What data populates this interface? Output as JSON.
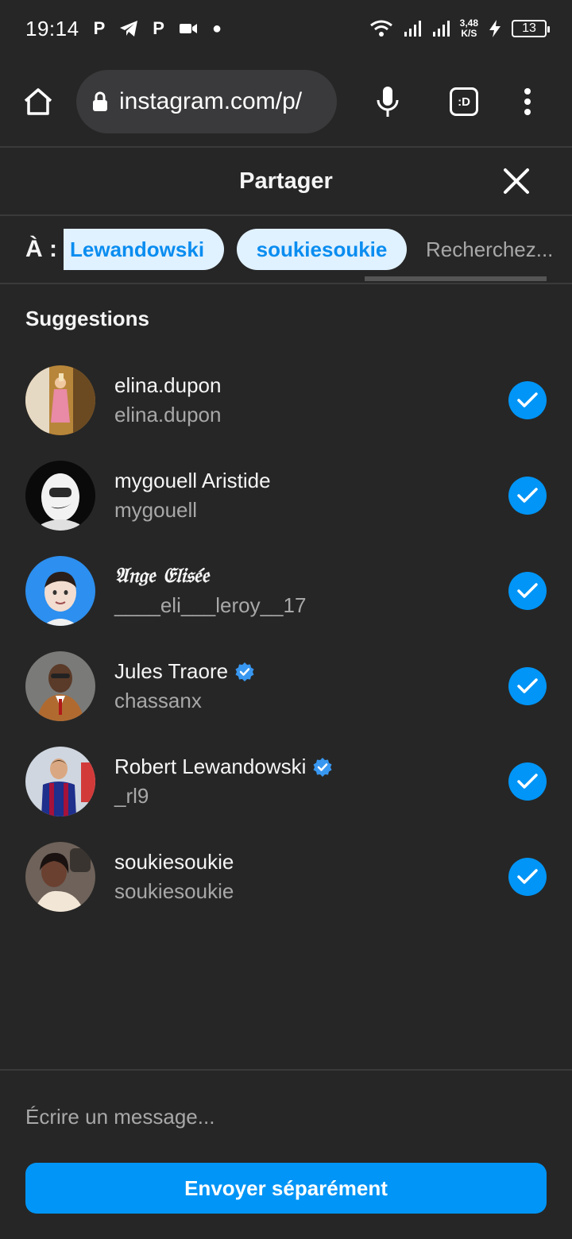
{
  "status_bar": {
    "time": "19:14",
    "speed": "3,48",
    "speed_unit": "K/S",
    "battery": "13",
    "icons": [
      "p-app-icon",
      "telegram-icon",
      "p-app-icon",
      "video-icon",
      "dot-icon",
      "wifi-icon",
      "signal-icon",
      "signal-icon",
      "charging-icon"
    ]
  },
  "browser": {
    "url": "instagram.com/p/",
    "tabs_label": ":D"
  },
  "share": {
    "title": "Partager",
    "to_label": "À :",
    "chips": [
      "Lewandowski",
      "soukiesoukie"
    ],
    "search_placeholder": "Recherchez...",
    "suggestions_title": "Suggestions"
  },
  "suggestions": [
    {
      "fullname": "elina.dupon",
      "username": "elina.dupon",
      "verified": false,
      "selected": true
    },
    {
      "fullname": "mygouell Aristide",
      "username": "mygouell",
      "verified": false,
      "selected": true
    },
    {
      "fullname": "𝔄𝔫𝔤𝔢 𝔈𝔩𝔦𝔰𝔢́𝔢",
      "username": "____eli___leroy__17",
      "verified": false,
      "selected": true
    },
    {
      "fullname": "Jules Traore",
      "username": "chassanx",
      "verified": true,
      "selected": true
    },
    {
      "fullname": "Robert Lewandowski",
      "username": "_rl9",
      "verified": true,
      "selected": true
    },
    {
      "fullname": "soukiesoukie",
      "username": "soukiesoukie",
      "verified": false,
      "selected": true
    }
  ],
  "footer": {
    "message_placeholder": "Écrire un message...",
    "send_label": "Envoyer séparément"
  },
  "colors": {
    "background": "#262626",
    "accent": "#0095f6",
    "chip_bg": "#e0f1ff",
    "chip_text": "#0a8df0",
    "secondary_text": "#a8a8a8"
  }
}
